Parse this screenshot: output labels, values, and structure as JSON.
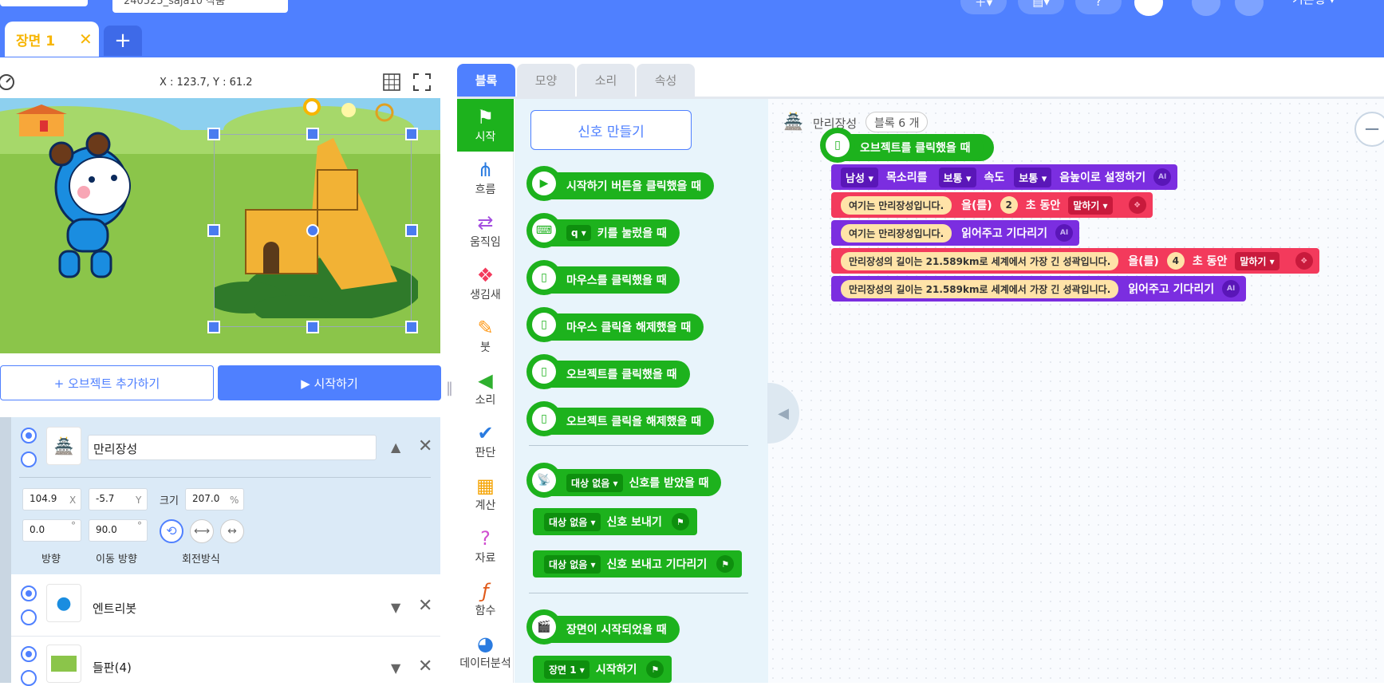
{
  "header": {
    "project_name": "240525_saja10 작품",
    "scene_tab": {
      "label": "장면 1",
      "close": "✕"
    },
    "add_scene": "+",
    "right_label": "기본형 ▾"
  },
  "stage": {
    "coordinates": "X : 123.7, Y : 61.2",
    "add_object_label": "+ 오브젝트 추가하기",
    "start_label": "▶ 시작하기"
  },
  "objects": [
    {
      "name": "만리장성",
      "x": "104.9",
      "y": "-5.7",
      "size": "207.0",
      "direction": "0.0",
      "move_direction": "90.0"
    },
    {
      "name": "엔트리봇"
    },
    {
      "name": "들판(4)"
    }
  ],
  "object_labels": {
    "x": "X",
    "y": "Y",
    "size": "크기",
    "percent": "%",
    "degree": "°",
    "direction": "방향",
    "move_direction": "이동 방향",
    "rotation": "회전방식"
  },
  "tabs": [
    "블록",
    "모양",
    "소리",
    "속성"
  ],
  "categories": [
    "시작",
    "흐름",
    "움직임",
    "생김새",
    "붓",
    "소리",
    "판단",
    "계산",
    "자료",
    "함수",
    "데이터분석"
  ],
  "palette": {
    "make_signal": "신호 만들기",
    "blocks": [
      "시작하기 버튼을 클릭했을 때",
      "키를 눌렀을 때",
      "마우스를 클릭했을 때",
      "마우스 클릭을 해제했을 때",
      "오브젝트를 클릭했을 때",
      "오브젝트 클릭을 해제했을 때",
      "신호를 받았을 때",
      "신호 보내기",
      "신호 보내고 기다리기",
      "장면이 시작되었을 때",
      "시작하기"
    ],
    "key_dd": "q",
    "signal_dd": "대상 없음",
    "scene_dd": "장면 1"
  },
  "workspace": {
    "object_name": "만리장성",
    "block_count": "블록 6 개",
    "hat": "오브젝트를 클릭했을 때",
    "b1": {
      "voice": "남성",
      "t1": "목소리를",
      "speed_dd": "보통",
      "t2": "속도",
      "pitch_dd": "보통",
      "t3": "음높이로 설정하기"
    },
    "b2": {
      "text": "여기는 만리장성입니다.",
      "t1": "을(를)",
      "num": "2",
      "t2": "초 동안",
      "dd": "말하기"
    },
    "b3": {
      "text": "여기는 만리장성입니다.",
      "t1": "읽어주고 기다리기"
    },
    "b4": {
      "text": "만리장성의 길이는 21.589km로 세계에서 가장 긴 성곽입니다.",
      "t1": "을(를)",
      "num": "4",
      "t2": "초 동안",
      "dd": "말하기"
    },
    "b5": {
      "text": "만리장성의 길이는 21.589km로 세계에서 가장 긴 성곽입니다.",
      "t1": "읽어주고 기다리기"
    }
  },
  "colors": {
    "brand": "#4f80ff",
    "start_green": "#1db21d",
    "ai_purple": "#7b2ee0",
    "looks_red": "#f33a5c"
  }
}
